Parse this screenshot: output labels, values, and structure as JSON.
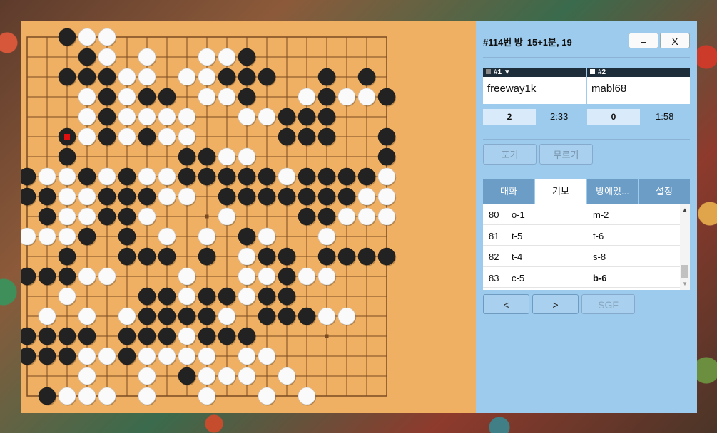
{
  "room": {
    "title": "#114번 방",
    "rule": "15+1분, 19"
  },
  "window": {
    "minimize_label": "–",
    "close_label": "X"
  },
  "players": [
    {
      "rank_label": "#1 ▼",
      "name": "freeway1k",
      "captures": "2",
      "time": "2:33",
      "stone_color": "#333333"
    },
    {
      "rank_label": "#2",
      "name": "mabl68",
      "captures": "0",
      "time": "1:58",
      "stone_color": "#ffffff"
    }
  ],
  "actions": {
    "resign_label": "포기",
    "undo_label": "무르기"
  },
  "tabs": [
    "대화",
    "기보",
    "방에있...",
    "설정"
  ],
  "active_tab": 1,
  "moves": [
    {
      "num": "80",
      "black": "o-1",
      "white": "m-2"
    },
    {
      "num": "81",
      "black": "t-5",
      "white": "t-6"
    },
    {
      "num": "82",
      "black": "t-4",
      "white": "s-8"
    },
    {
      "num": "83",
      "black": "c-5",
      "white": "b-6"
    }
  ],
  "nav": {
    "prev_label": "<",
    "next_label": ">",
    "sgf_label": "SGF"
  },
  "colors": {
    "board": "#f0b063",
    "panel": "#9dcbed",
    "line": "#7a4a22",
    "last_move": "#e01010"
  },
  "board": {
    "size": 19,
    "columns": "abcdefghjklmnopqrst",
    "rows": [
      "..bww..............",
      "...bw.w..wwb.......",
      "..bbbww.wwbbb..b.b.",
      "...wbwbb.wwb..wbwwb",
      "...wbwwww..wwbbb...",
      "..bwbwbww....bbb..b",
      "..b.....bbww......b",
      "bwwbwbwwbbbbbwbbbbw",
      "bbwwbbbww.bbbbbbbww",
      ".bwwbbw...w...bbwww",
      "wwwb.b.w.w.bw..w...",
      "..b..bbb.b.wbb.bbbb",
      "bbbww...w..wwbww...",
      "..w...bbwbbwbb.....",
      ".w.w.wbbbbw.bbbww..",
      "bbbb.bbbwbbb.......",
      "bbbwwbwwww.ww......",
      "...w..w.bwww.w.....",
      ".bwww.w..w..w.w...."
    ],
    "last_move": "c-5",
    "note": "row strings map 19x19 intersections: b=black, w=white, .=empty; row index = vertical line from top"
  }
}
